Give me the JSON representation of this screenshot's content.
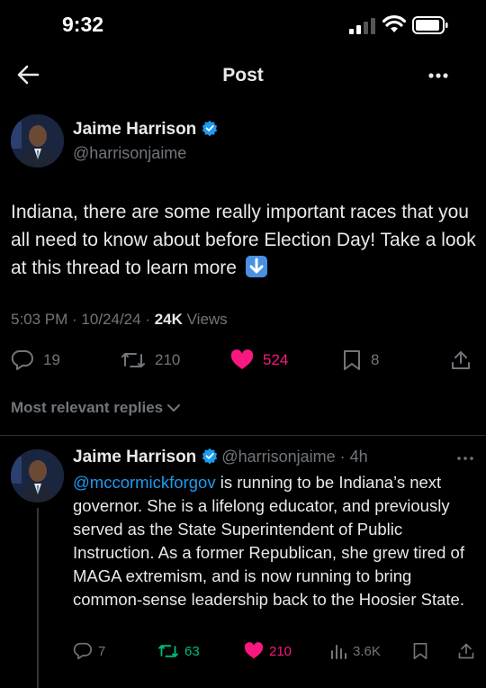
{
  "status_bar": {
    "time": "9:32"
  },
  "nav": {
    "title": "Post",
    "back_icon": "arrow-left-icon",
    "more_icon": "more-horizontal-icon"
  },
  "post": {
    "author_name": "Jaime Harrison",
    "author_handle": "@harrisonjaime",
    "verified": true,
    "text": "Indiana, there are some really important races that you all need to know about before Election Day! Take a look at this thread to learn more",
    "emoji": "down-arrow-emoji",
    "time": "5:03 PM",
    "date": "10/24/24",
    "views_count": "24K",
    "views_label": "Views",
    "replies": "19",
    "reposts": "210",
    "likes": "524",
    "bookmarks": "8",
    "like_color": "#f91880"
  },
  "replies_filter": {
    "label": "Most relevant replies"
  },
  "reply": {
    "author_name": "Jaime Harrison",
    "author_handle": "@harrisonjaime",
    "age": "4h",
    "mention": "@mccormickforgov",
    "text": " is running to be Indiana’s next governor. She is a lifelong educator, and previously served as the State Superintendent of Public Instruction. As a former Republican, she grew tired of MAGA extremism, and is now running to bring common-sense leadership back to the Hoosier State.",
    "replies": "7",
    "reposts": "63",
    "likes": "210",
    "views": "3.6K",
    "repost_color": "#00ba7c",
    "mention_color": "#1d9bf0"
  }
}
